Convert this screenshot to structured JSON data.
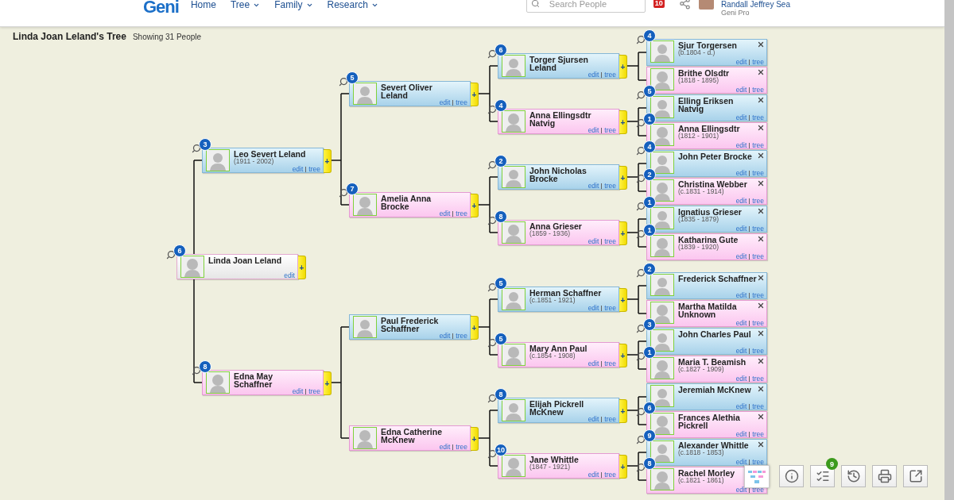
{
  "header": {
    "logo": "Geni",
    "nav": [
      {
        "label": "Home",
        "dropdown": false
      },
      {
        "label": "Tree",
        "dropdown": true
      },
      {
        "label": "Family",
        "dropdown": true
      },
      {
        "label": "Research",
        "dropdown": true
      }
    ],
    "search": {
      "placeholder": "Search People"
    },
    "notifications": "10",
    "user": {
      "name": "Randall Jeffrey Sea",
      "plan": "Geni Pro"
    }
  },
  "page": {
    "title": "Linda Joan Leland's Tree",
    "count": "Showing 31 People"
  },
  "tree": {
    "name": "Linda Joan Leland",
    "kind": "focus",
    "badge": "6",
    "links": [
      "edit"
    ],
    "expand": "+",
    "removable": false,
    "parents": [
      {
        "name": "Leo Severt Leland",
        "dates": "(1911 - 2002)",
        "kind": "male",
        "badge": "3",
        "links": [
          "edit",
          "tree"
        ],
        "expand": "+",
        "removable": false,
        "parents": [
          {
            "name": "Severt Oliver Leland",
            "kind": "male",
            "badge": "5",
            "links": [
              "edit",
              "tree"
            ],
            "expand": "+",
            "removable": false,
            "parents": [
              {
                "name": "Torger Sjursen Leland",
                "kind": "male",
                "badge": "6",
                "links": [
                  "edit",
                  "tree"
                ],
                "expand": "+",
                "removable": false,
                "parents": [
                  {
                    "name": "Sjur Torgersen",
                    "dates": "(b.1804 - d.)",
                    "kind": "male",
                    "badge": "4",
                    "links": [
                      "edit",
                      "tree"
                    ],
                    "removable": true
                  },
                  {
                    "name": "Brithe Olsdtr",
                    "dates": "(1818 - 1895)",
                    "kind": "female",
                    "links": [
                      "edit",
                      "tree"
                    ],
                    "removable": true
                  }
                ]
              },
              {
                "name": "Anna Ellingsdtr Natvig",
                "kind": "female",
                "badge": "4",
                "links": [
                  "edit",
                  "tree"
                ],
                "expand": "+",
                "removable": false,
                "parents": [
                  {
                    "name": "Elling Eriksen Natvig",
                    "kind": "male",
                    "badge": "5",
                    "links": [
                      "edit",
                      "tree"
                    ],
                    "removable": true
                  },
                  {
                    "name": "Anna Ellingsdtr",
                    "dates": "(1812 - 1901)",
                    "kind": "female",
                    "badge": "1",
                    "links": [
                      "edit",
                      "tree"
                    ],
                    "removable": true
                  }
                ]
              }
            ]
          },
          {
            "name": "Amelia Anna Brocke",
            "kind": "female",
            "badge": "7",
            "links": [
              "edit",
              "tree"
            ],
            "expand": "+",
            "removable": false,
            "parents": [
              {
                "name": "John Nicholas Brocke",
                "kind": "male",
                "badge": "2",
                "links": [
                  "edit",
                  "tree"
                ],
                "expand": "+",
                "removable": false,
                "parents": [
                  {
                    "name": "John Peter Brocke",
                    "kind": "male",
                    "badge": "4",
                    "links": [
                      "edit",
                      "tree"
                    ],
                    "removable": true
                  },
                  {
                    "name": "Christina Webber",
                    "dates": "(c.1831 - 1914)",
                    "kind": "female",
                    "badge": "2",
                    "links": [
                      "edit",
                      "tree"
                    ],
                    "removable": true
                  }
                ]
              },
              {
                "name": "Anna Grieser",
                "dates": "(1859 - 1936)",
                "kind": "female",
                "badge": "8",
                "links": [
                  "edit",
                  "tree"
                ],
                "expand": "+",
                "removable": false,
                "parents": [
                  {
                    "name": "Ignatius Grieser",
                    "dates": "(1835 - 1879)",
                    "kind": "male",
                    "badge": "1",
                    "links": [
                      "edit",
                      "tree"
                    ],
                    "removable": true
                  },
                  {
                    "name": "Katharina Gute",
                    "dates": "(1839 - 1920)",
                    "kind": "female",
                    "badge": "1",
                    "links": [
                      "edit",
                      "tree"
                    ],
                    "removable": true
                  }
                ]
              }
            ]
          }
        ]
      },
      {
        "name": "Edna May Schaffner",
        "kind": "female",
        "badge": "8",
        "links": [
          "edit",
          "tree"
        ],
        "expand": "+",
        "removable": false,
        "parents": [
          {
            "name": "Paul Frederick Schaffner",
            "kind": "male",
            "links": [
              "edit",
              "tree"
            ],
            "expand": "+",
            "removable": false,
            "parents": [
              {
                "name": "Herman Schaffner",
                "dates": "(c.1851 - 1921)",
                "kind": "male",
                "badge": "5",
                "links": [
                  "edit",
                  "tree"
                ],
                "expand": "+",
                "removable": false,
                "parents": [
                  {
                    "name": "Frederick Schaffner",
                    "kind": "male",
                    "badge": "2",
                    "links": [
                      "edit",
                      "tree"
                    ],
                    "removable": true
                  },
                  {
                    "name": "Martha Matilda Unknown",
                    "kind": "female",
                    "links": [
                      "edit",
                      "tree"
                    ],
                    "removable": true
                  }
                ]
              },
              {
                "name": "Mary Ann Paul",
                "dates": "(c.1854 - 1908)",
                "kind": "female",
                "badge": "5",
                "links": [
                  "edit",
                  "tree"
                ],
                "expand": "+",
                "removable": false,
                "parents": [
                  {
                    "name": "John Charles Paul",
                    "kind": "male",
                    "badge": "3",
                    "links": [
                      "edit",
                      "tree"
                    ],
                    "removable": true
                  },
                  {
                    "name": "Maria T. Beamish",
                    "dates": "(c.1827 - 1909)",
                    "kind": "female",
                    "badge": "1",
                    "links": [
                      "edit",
                      "tree"
                    ],
                    "removable": true
                  }
                ]
              }
            ]
          },
          {
            "name": "Edna Catherine McKnew",
            "kind": "female",
            "links": [
              "edit",
              "tree"
            ],
            "expand": "+",
            "removable": false,
            "parents": [
              {
                "name": "Elijah Pickrell McKnew",
                "kind": "male",
                "badge": "8",
                "links": [
                  "edit",
                  "tree"
                ],
                "expand": "+",
                "removable": false,
                "parents": [
                  {
                    "name": "Jeremiah McKnew",
                    "kind": "male",
                    "links": [
                      "edit",
                      "tree"
                    ],
                    "removable": true
                  },
                  {
                    "name": "Frances Alethia Pickrell",
                    "kind": "female",
                    "badge": "6",
                    "links": [
                      "edit",
                      "tree"
                    ],
                    "removable": true
                  }
                ]
              },
              {
                "name": "Jane Whittle",
                "dates": "(1847 - 1921)",
                "kind": "female",
                "badge": "10",
                "links": [
                  "edit",
                  "tree"
                ],
                "expand": "+",
                "removable": false,
                "parents": [
                  {
                    "name": "Alexander Whittle",
                    "dates": "(c.1818 - 1853)",
                    "kind": "male",
                    "badge": "9",
                    "links": [
                      "edit",
                      "tree"
                    ],
                    "removable": true
                  },
                  {
                    "name": "Rachel Morley",
                    "dates": "(c.1821 - 1861)",
                    "kind": "female",
                    "badge": "8",
                    "links": [
                      "edit",
                      "tree"
                    ],
                    "removable": false
                  }
                ]
              }
            ]
          }
        ]
      }
    ]
  },
  "toolbar": {
    "todo_count": "9"
  }
}
